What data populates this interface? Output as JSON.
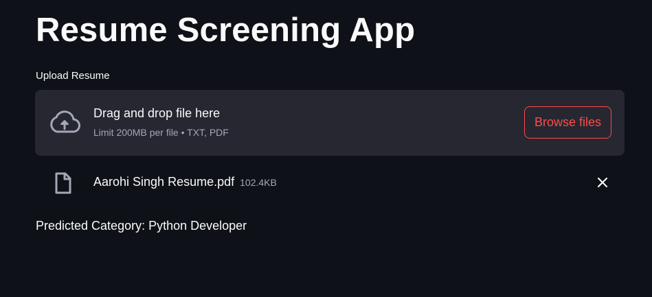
{
  "page": {
    "title": "Resume Screening App"
  },
  "uploader": {
    "label": "Upload Resume",
    "dropzone_text": "Drag and drop file here",
    "limit_text": "Limit 200MB per file • TXT, PDF",
    "browse_label": "Browse files",
    "upload_icon": "cloud-upload-icon"
  },
  "uploaded_file": {
    "name": "Aarohi Singh Resume.pdf",
    "size": "102.4KB",
    "file_icon": "file-icon",
    "remove_icon": "close-icon"
  },
  "result": {
    "text": "Predicted Category: Python Developer"
  },
  "colors": {
    "background": "#0e1117",
    "panel": "#262730",
    "accent": "#ff4b4b",
    "text": "#fafafa",
    "muted_text": "#a3a8b8"
  }
}
